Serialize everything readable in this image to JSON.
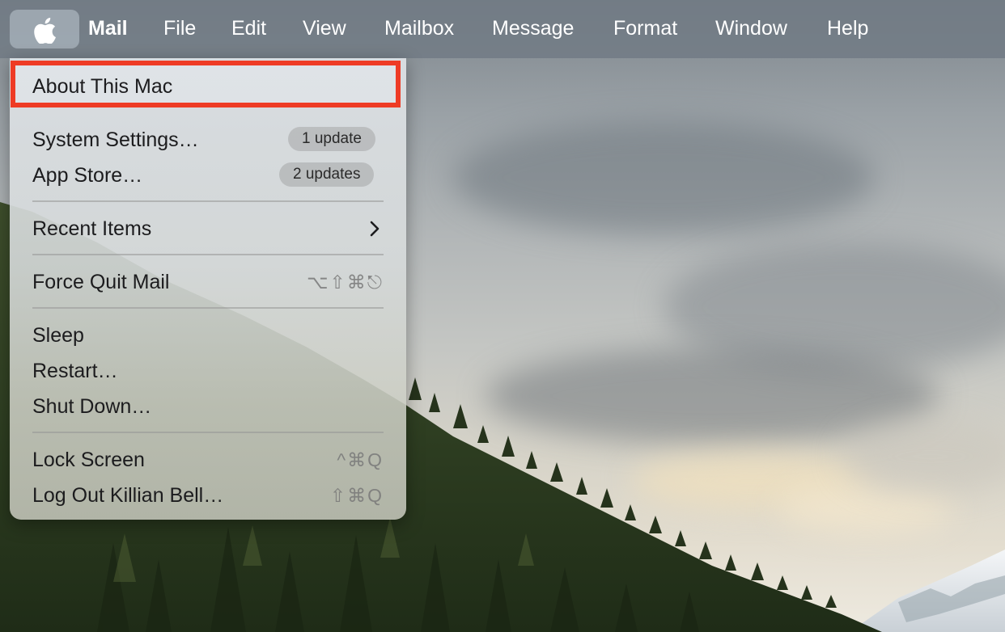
{
  "menubar": {
    "app_name": "Mail",
    "menus": [
      "File",
      "Edit",
      "View",
      "Mailbox",
      "Message",
      "Format",
      "Window",
      "Help"
    ],
    "apple_icon": "apple-logo-icon"
  },
  "apple_menu": {
    "about": "About This Mac",
    "system_settings": {
      "label": "System Settings…",
      "badge": "1 update"
    },
    "app_store": {
      "label": "App Store…",
      "badge": "2 updates"
    },
    "recent_items": {
      "label": "Recent Items",
      "icon": "chevron-right-icon"
    },
    "force_quit": {
      "label": "Force Quit Mail",
      "shortcut": "⌥⇧⌘⎋"
    },
    "sleep": "Sleep",
    "restart": "Restart…",
    "shut_down": "Shut Down…",
    "lock_screen": {
      "label": "Lock Screen",
      "shortcut": "^⌘Q"
    },
    "log_out": {
      "label": "Log Out Killian Bell…",
      "shortcut": "⇧⌘Q"
    }
  },
  "colors": {
    "highlight_border": "#ee3b25",
    "menubar_bg": "#707a84",
    "forest": "#2e3d22"
  }
}
